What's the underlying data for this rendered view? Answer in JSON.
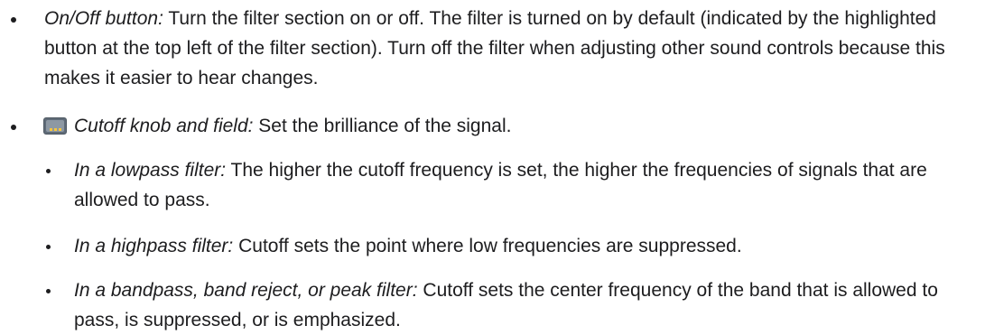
{
  "colors": {
    "text": "#1d1d1f",
    "background": "#ffffff",
    "icon_body": "#5f6b78",
    "icon_accent": "#f4c542"
  },
  "items": [
    {
      "term": "On/Off button:",
      "text": " Turn the filter section on or off. The filter is turned on by default (indicated by the highlighted button at the top left of the filter section). Turn off the filter when adjusting other sound controls because this makes it easier to hear changes."
    },
    {
      "icon": "cutoff-knob-icon",
      "term": "Cutoff knob and field:",
      "text": " Set the brilliance of the signal.",
      "subitems": [
        {
          "term": "In a lowpass filter:",
          "text": " The higher the cutoff frequency is set, the higher the frequencies of signals that are allowed to pass."
        },
        {
          "term": "In a highpass filter:",
          "text": " Cutoff sets the point where low frequencies are suppressed."
        },
        {
          "term": "In a bandpass, band reject, or peak filter:",
          "text": " Cutoff sets the center frequency of the band that is allowed to pass, is suppressed, or is emphasized."
        }
      ]
    }
  ]
}
